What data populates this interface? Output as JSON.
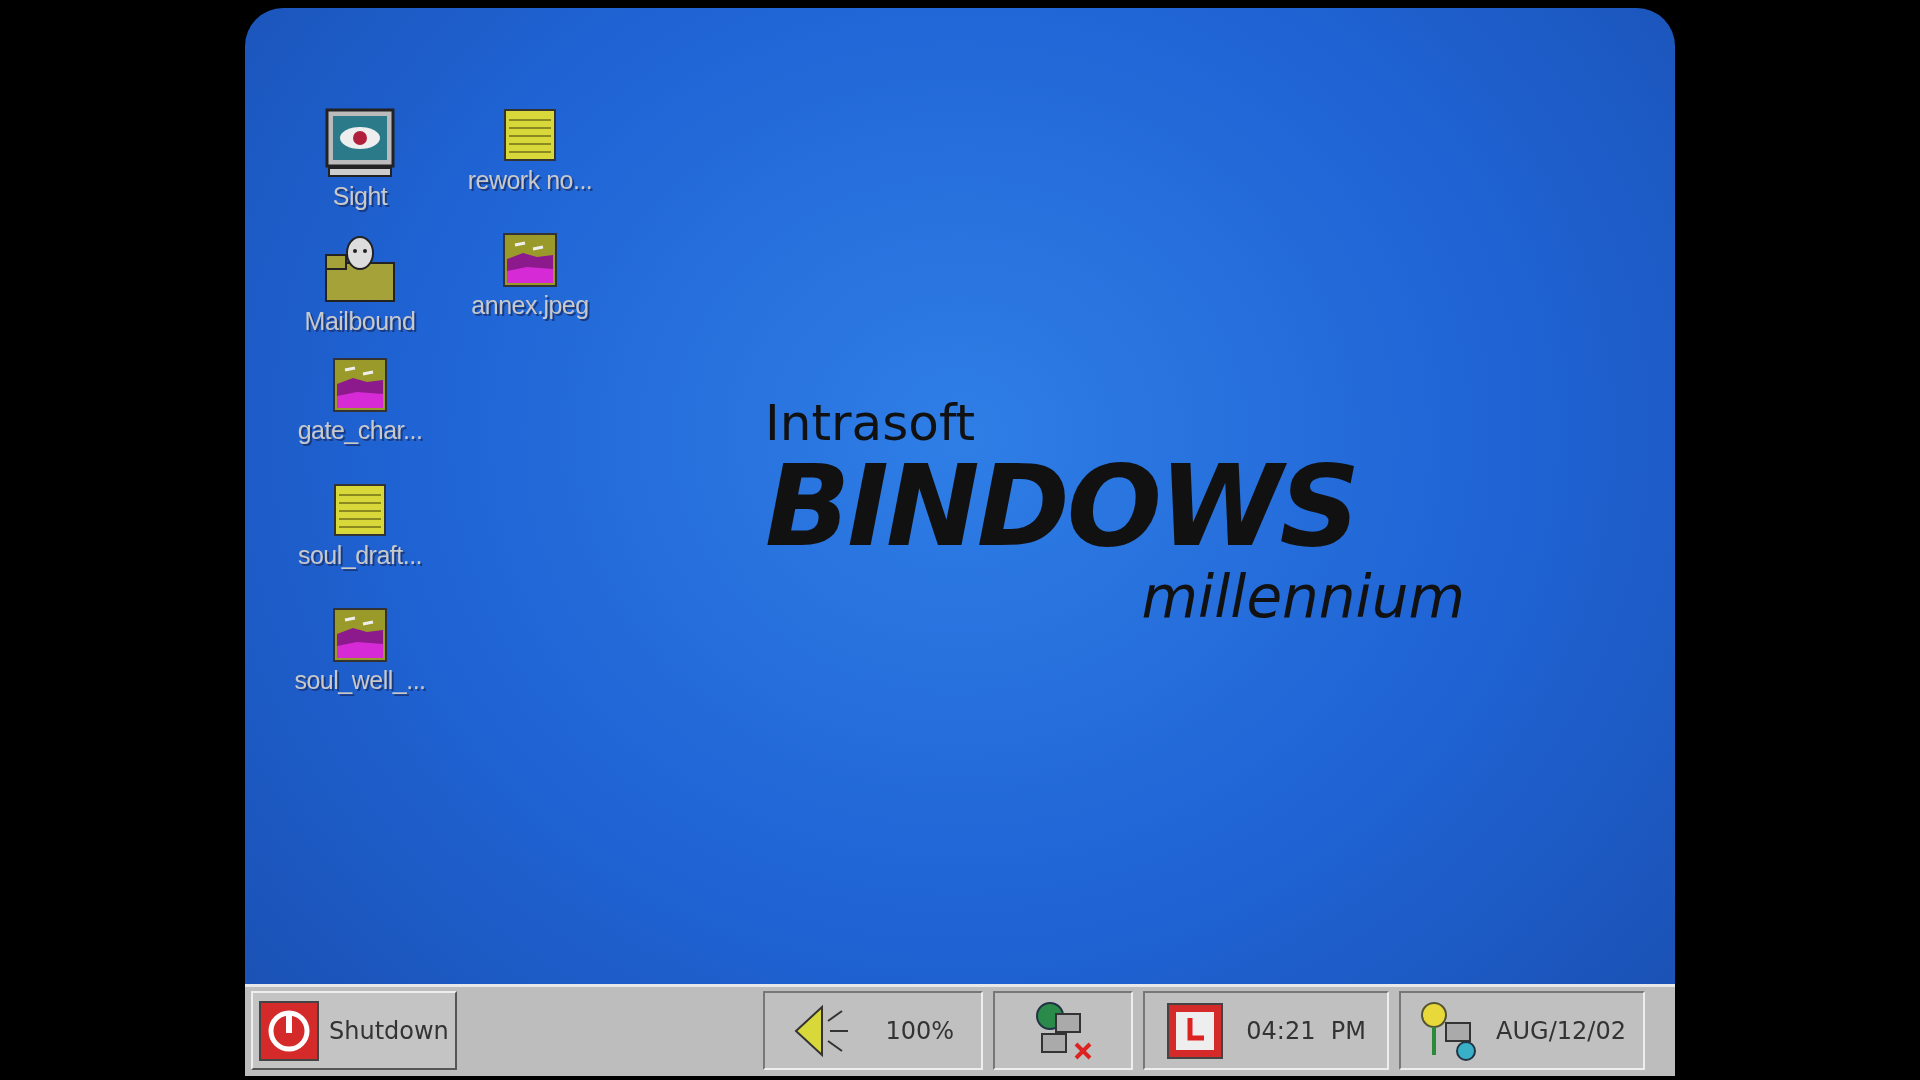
{
  "desktop": {
    "icons": [
      {
        "kind": "eye-monitor",
        "label": "Sight"
      },
      {
        "kind": "notepad",
        "label": "rework no..."
      },
      {
        "kind": "mail-folder",
        "label": "Mailbound"
      },
      {
        "kind": "image",
        "label": "annex.jpeg"
      },
      {
        "kind": "image",
        "label": "gate_char..."
      },
      {
        "kind": "empty"
      },
      {
        "kind": "notepad",
        "label": "soul_draft..."
      },
      {
        "kind": "empty"
      },
      {
        "kind": "image",
        "label": "soul_well_..."
      }
    ]
  },
  "logo": {
    "brand": "Intrasoft",
    "product": "BINDOWS",
    "edition": "millennium"
  },
  "taskbar": {
    "start_button": {
      "label": "Shutdown"
    },
    "volume": {
      "reading": "100%"
    },
    "clock": {
      "time": "04:21  PM"
    },
    "date": {
      "text": "AUG/12/02"
    }
  }
}
